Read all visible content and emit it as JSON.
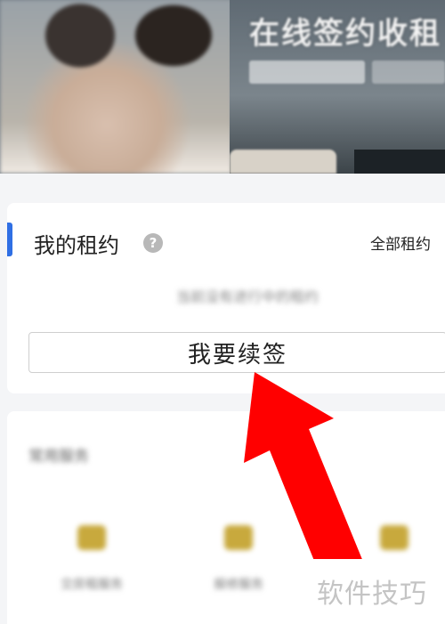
{
  "banner": {
    "title": "在线签约收租",
    "subtitle": ""
  },
  "rental_card": {
    "title": "我的租约",
    "help_icon": "question-circle-icon",
    "all_link": "全部租约",
    "empty_hint": "当前没有进行中的租约",
    "renew_button": "我要续签"
  },
  "services": {
    "title": "常用服务",
    "items": [
      {
        "label": "交房租服务",
        "icon": "wallet-icon"
      },
      {
        "label": "报修服务",
        "icon": "wallet-icon"
      },
      {
        "label": "",
        "icon": "wallet-icon"
      }
    ]
  },
  "watermark": "软件技巧",
  "colors": {
    "accent": "#2f6fe4",
    "arrow": "#ff0000"
  }
}
